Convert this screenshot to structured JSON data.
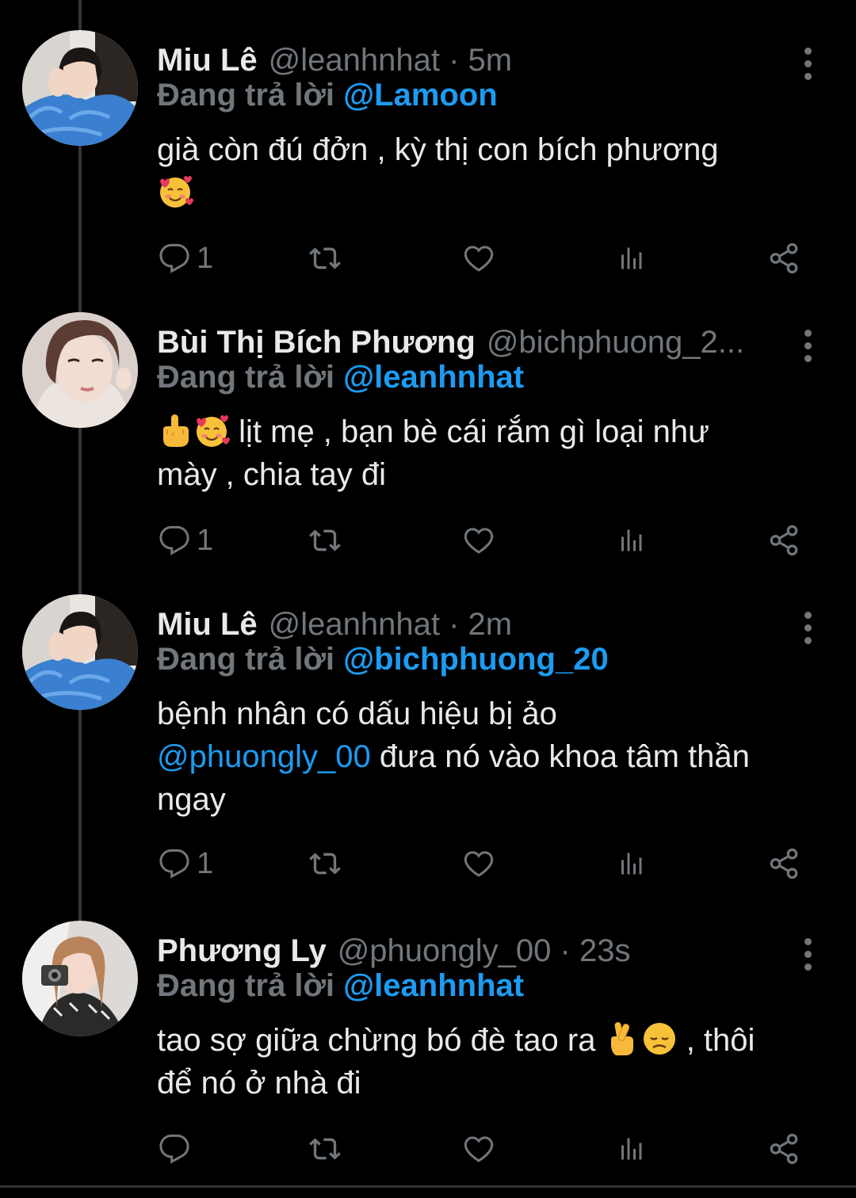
{
  "tweets": [
    {
      "name": "Miu Lê",
      "handle_meta": "@leanhnhat · 5m",
      "reply_label": "Đang trả lời",
      "reply_mention": "@Lamoon",
      "text_line1": "già còn đú đởn , kỳ thị con bích phương",
      "reply_count": "1",
      "avatar": "avatar-miu-le"
    },
    {
      "name": "Bùi Thị Bích Phương",
      "handle_meta": "@bichphuong_2...",
      "reply_label": "Đang trả lời",
      "reply_mention": "@leanhnhat",
      "text_line1": "lịt mẹ  , bạn bè cái rắm gì loại như",
      "text_line2": "mày , chia tay đi",
      "reply_count": "1",
      "avatar": "avatar-bich-phuong"
    },
    {
      "name": "Miu Lê",
      "handle_meta": "@leanhnhat · 2m",
      "reply_label": "Đang trả lời",
      "reply_mention": "@bichphuong_20",
      "text_line1": "bệnh nhân có dấu hiệu bị ảo",
      "text_mention": "@phuongly_00",
      "text_line2_rest": " đưa nó vào khoa tâm thần",
      "text_line3": "ngay",
      "reply_count": "1",
      "avatar": "avatar-miu-le"
    },
    {
      "name": "Phương Ly",
      "handle_meta": "@phuongly_00 · 23s",
      "reply_label": "Đang trả lời",
      "reply_mention": "@leanhnhat",
      "text_line1": "tao sợ giữa chừng bó đè tao ra",
      "text_line1_rest": " , thôi",
      "text_line2": "để nó ở nhà đi",
      "reply_count": "",
      "avatar": "avatar-phuong-ly"
    }
  ],
  "icons": {
    "reply": "reply-icon",
    "retweet": "retweet-icon",
    "like": "heart-icon",
    "views": "analytics-icon",
    "share": "share-icon",
    "more": "more-vertical-icon"
  },
  "colors": {
    "background": "#000000",
    "text": "#e7e9ea",
    "secondary": "#71767b",
    "mention": "#1d9bf0",
    "thread_line": "#333639"
  }
}
